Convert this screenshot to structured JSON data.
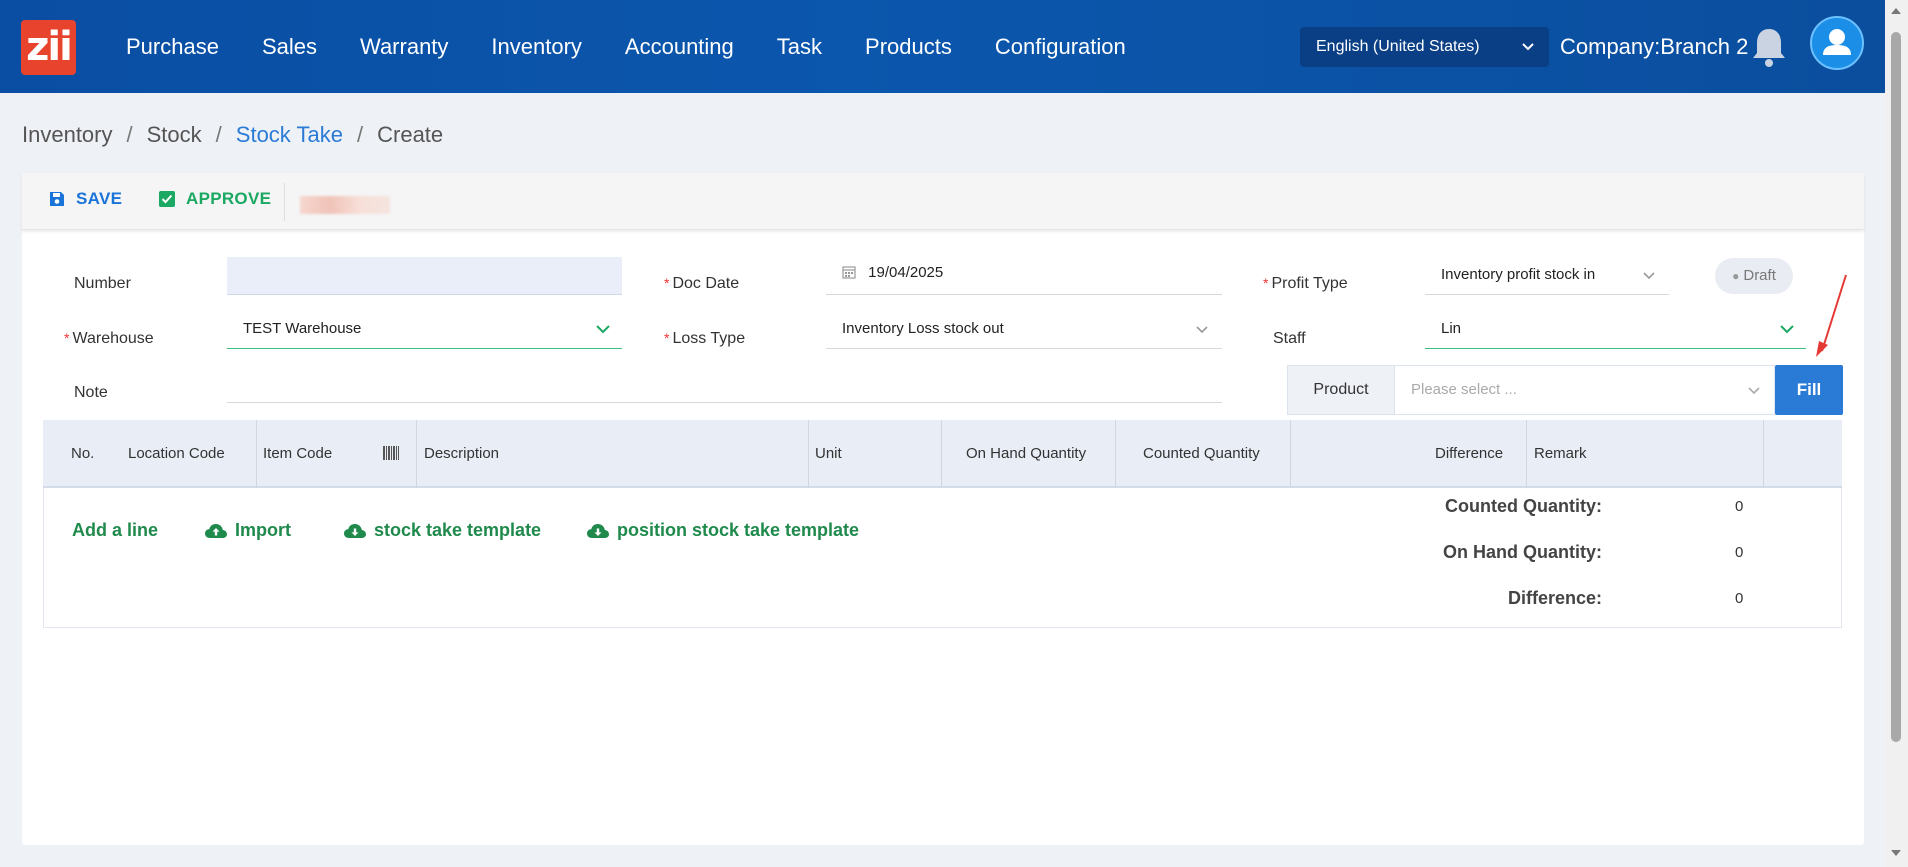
{
  "app": {
    "logo_text": "zii"
  },
  "nav": {
    "items": [
      "Purchase",
      "Sales",
      "Warranty",
      "Inventory",
      "Accounting",
      "Task",
      "Products",
      "Configuration"
    ],
    "language": "English (United States)",
    "company": "Company:Branch 2"
  },
  "breadcrumb": {
    "items": [
      "Inventory",
      "Stock",
      "Stock Take",
      "Create"
    ]
  },
  "toolbar": {
    "save_label": "SAVE",
    "approve_label": "APPROVE"
  },
  "form": {
    "number_label": "Number",
    "number_value": "",
    "doc_date_label": "Doc Date",
    "doc_date_value": "19/04/2025",
    "profit_type_label": "Profit Type",
    "profit_type_value": "Inventory profit stock in",
    "status": "Draft",
    "warehouse_label": "Warehouse",
    "warehouse_value": "TEST Warehouse",
    "loss_type_label": "Loss Type",
    "loss_type_value": "Inventory Loss stock out",
    "staff_label": "Staff",
    "staff_value": "Lin",
    "note_label": "Note",
    "note_value": "",
    "product_label": "Product",
    "product_placeholder": "Please select ...",
    "fill_label": "Fill"
  },
  "table": {
    "columns": [
      "No.",
      "Location Code",
      "Item Code",
      "Description",
      "Unit",
      "On Hand Quantity",
      "Counted Quantity",
      "Difference",
      "Remark"
    ],
    "rows": []
  },
  "actions": {
    "add_line": "Add a line",
    "import": "Import",
    "stock_take_template": "stock take template",
    "position_template": "position stock take template"
  },
  "summary": {
    "counted_label": "Counted Quantity:",
    "counted_value": "0",
    "on_hand_label": "On Hand Quantity:",
    "on_hand_value": "0",
    "difference_label": "Difference:",
    "difference_value": "0"
  },
  "colors": {
    "nav_bg": "#0b57ad",
    "accent_blue": "#2a7bd6",
    "accent_green": "#1aa862",
    "logo_red": "#e8432c"
  }
}
